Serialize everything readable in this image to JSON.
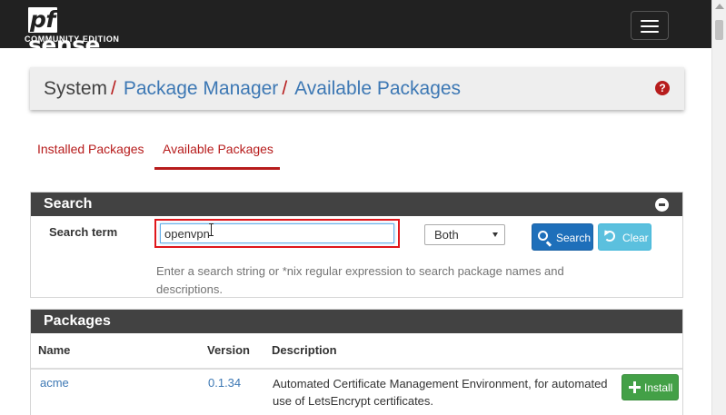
{
  "brand": {
    "main_prefix": "pf",
    "main_suffix": "sense",
    "edition": "COMMUNITY EDITION"
  },
  "breadcrumb": {
    "system": "System",
    "separator": "/",
    "package_manager": "Package Manager",
    "available_packages": "Available Packages",
    "help_glyph": "?"
  },
  "tabs": [
    {
      "label": "Installed Packages",
      "active": false
    },
    {
      "label": "Available Packages",
      "active": true
    }
  ],
  "search_panel": {
    "title": "Search",
    "term_label": "Search term",
    "input_value": "openvpn",
    "scope_selected": "Both",
    "search_button": "Search",
    "clear_button": "Clear",
    "help_text": "Enter a search string or *nix regular expression to search package names and descriptions."
  },
  "packages_panel": {
    "title": "Packages",
    "columns": [
      "Name",
      "Version",
      "Description"
    ],
    "rows": [
      {
        "name": "acme",
        "version": "0.1.34",
        "description": "Automated Certificate Management Environment, for automated use of LetsEncrypt certificates.",
        "action": "Install"
      }
    ]
  },
  "colors": {
    "navbar": "#212121",
    "accent_red": "#b71c1c",
    "link_blue": "#3d78b4",
    "panel_head": "#424242",
    "search_button": "#1e6fba",
    "clear_button": "#5bc0de",
    "install_button": "#43a047",
    "highlight_box": "#e0161b"
  },
  "icons": {
    "menu": "hamburger-icon",
    "help": "question-circle-icon",
    "collapse": "minus-circle-icon",
    "search": "magnifier-icon",
    "clear": "undo-icon",
    "install": "plus-icon",
    "cursor": "text-cursor-icon"
  }
}
